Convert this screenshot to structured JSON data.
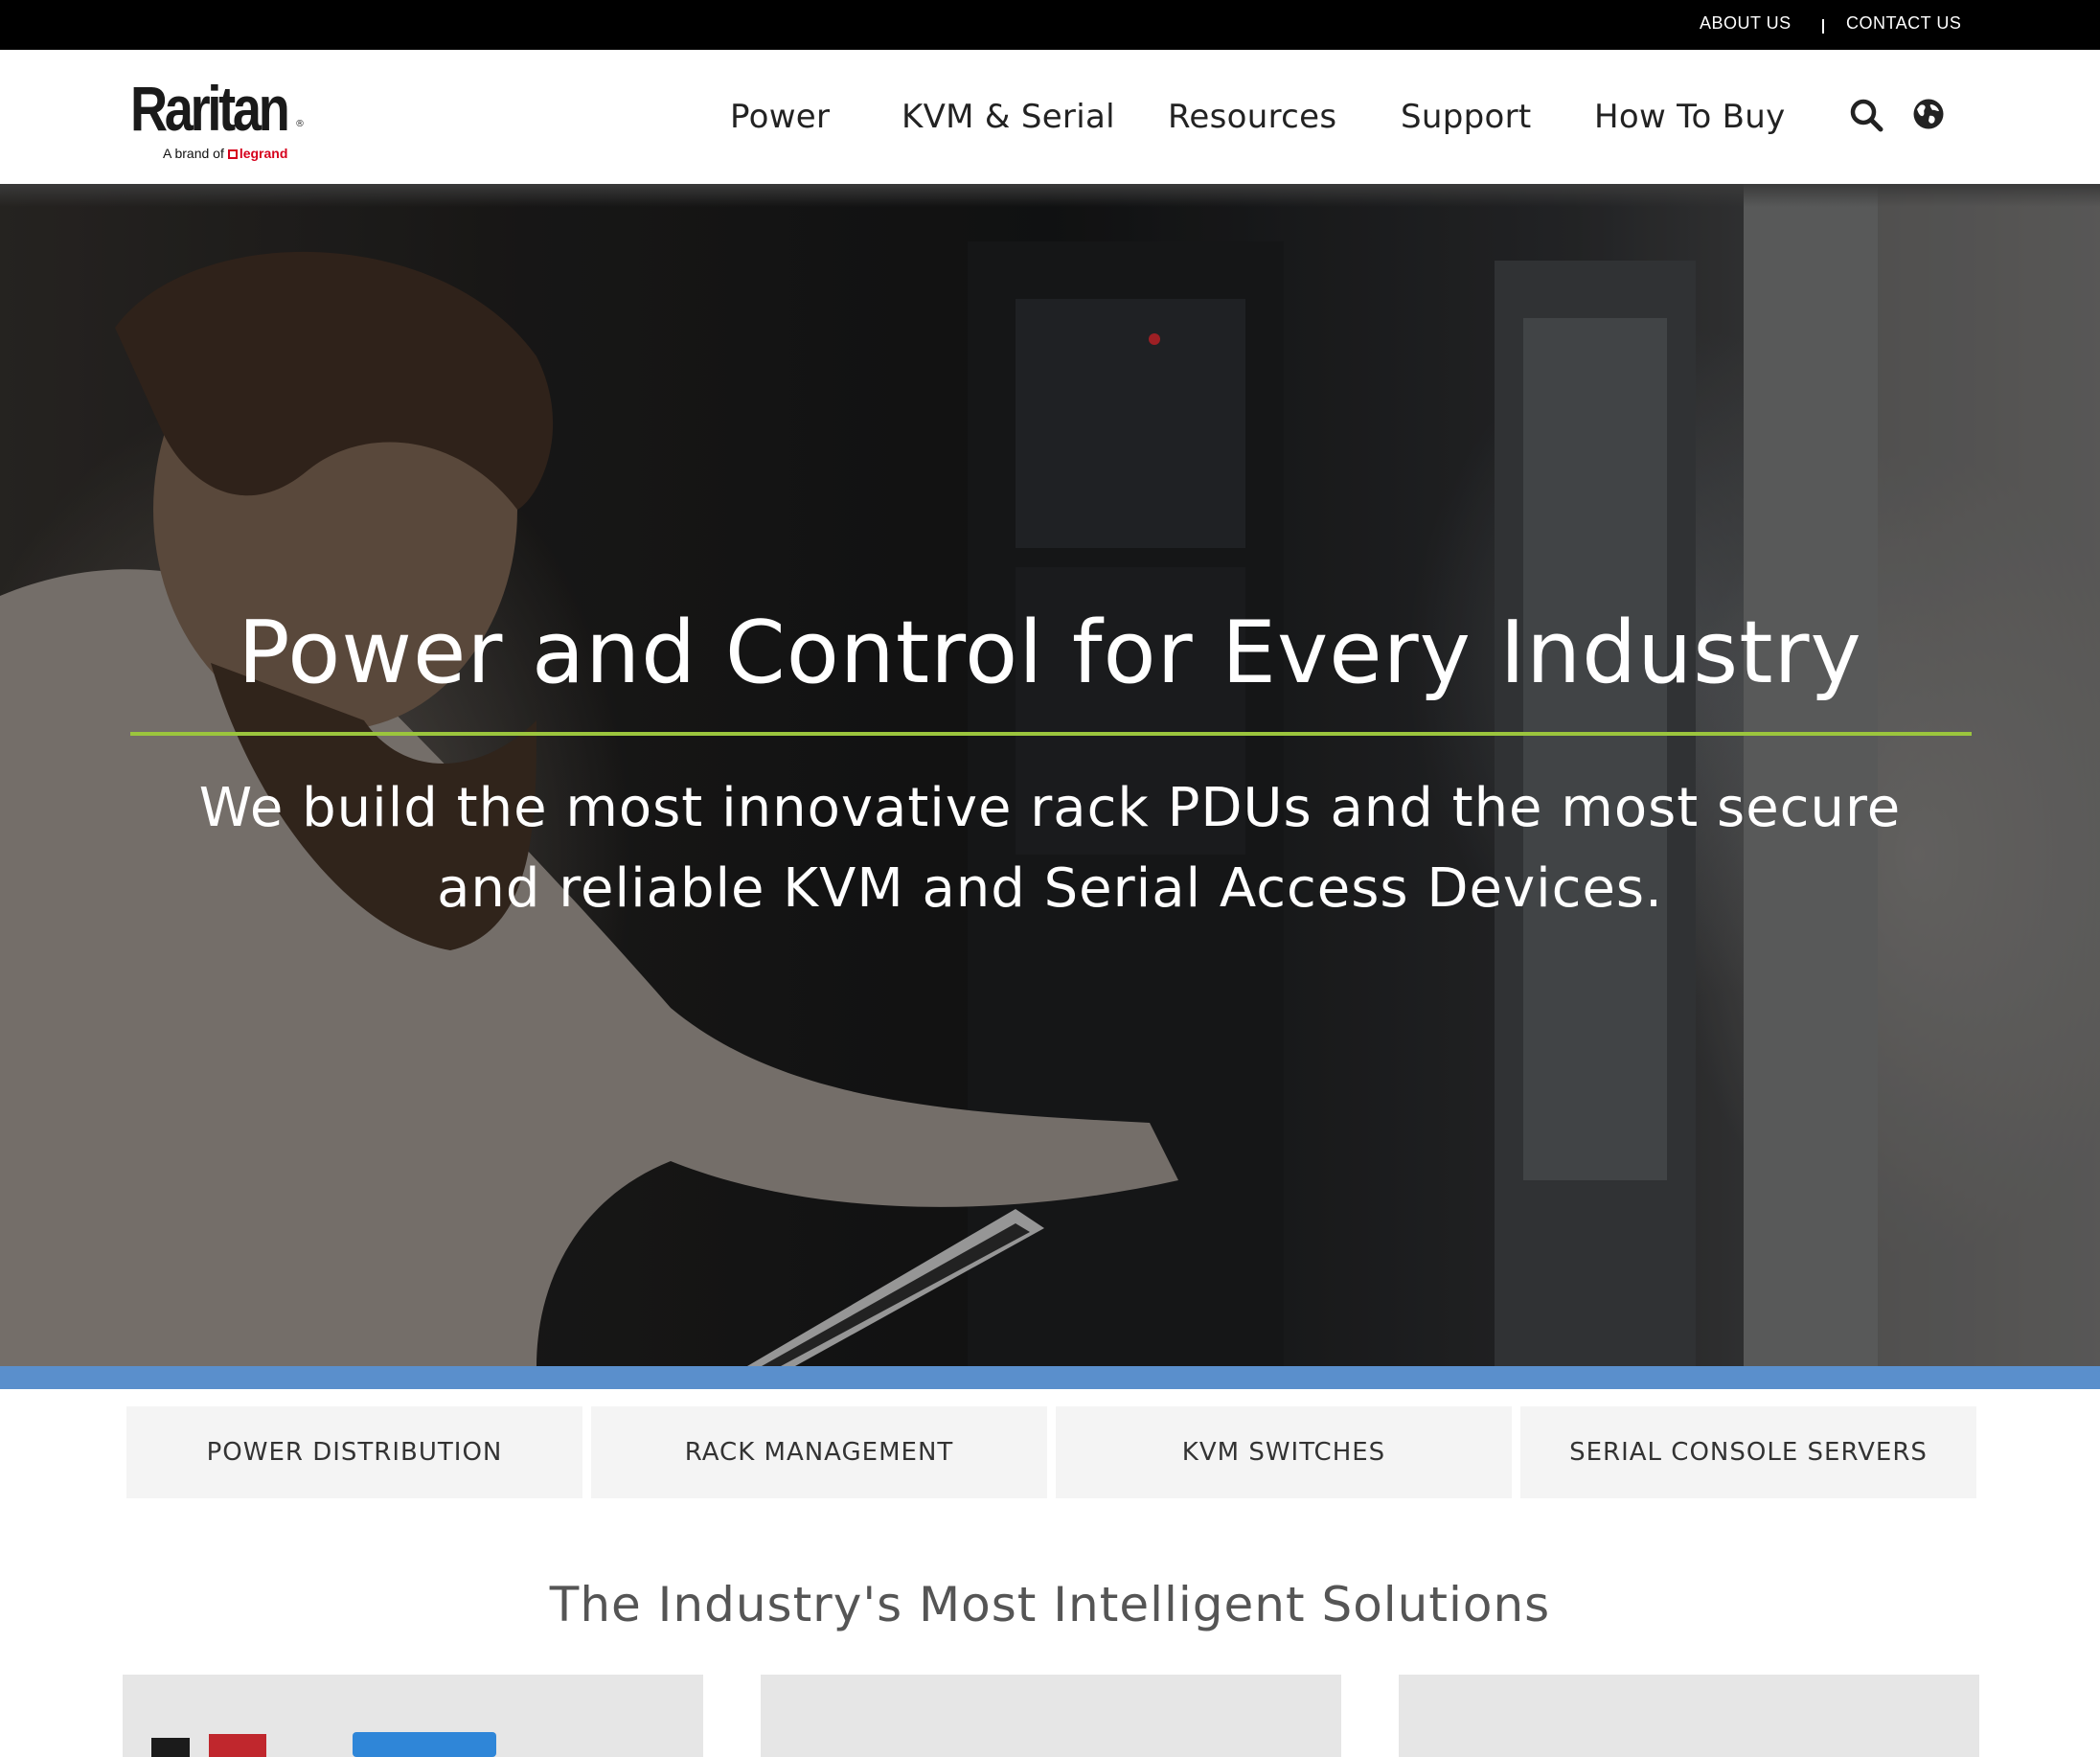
{
  "utility_bar": {
    "about_label": "ABOUT US",
    "contact_label": "CONTACT US"
  },
  "header": {
    "logo_text": "Raritan",
    "logo_tagline": "A brand of",
    "logo_brand": "legrand",
    "nav": [
      {
        "label": "Power"
      },
      {
        "label": "KVM & Serial"
      },
      {
        "label": "Resources"
      },
      {
        "label": "Support"
      },
      {
        "label": "How To Buy"
      }
    ],
    "icons": [
      "search-icon",
      "globe-icon"
    ]
  },
  "hero": {
    "title": "Power and Control for Every Industry",
    "subtitle": "We build the most innovative rack PDUs and the most secure and reliable KVM and Serial Access Devices.",
    "rule_color": "#9bc53d",
    "band_color": "#5a8fcc"
  },
  "categories": [
    {
      "label": "POWER DISTRIBUTION"
    },
    {
      "label": "RACK MANAGEMENT"
    },
    {
      "label": "KVM SWITCHES"
    },
    {
      "label": "SERIAL CONSOLE SERVERS"
    }
  ],
  "solutions": {
    "heading": "The Industry's Most Intelligent Solutions"
  },
  "colors": {
    "brand_red": "#d6001c",
    "accent_green": "#9bc53d",
    "accent_blue": "#5a8fcc"
  }
}
